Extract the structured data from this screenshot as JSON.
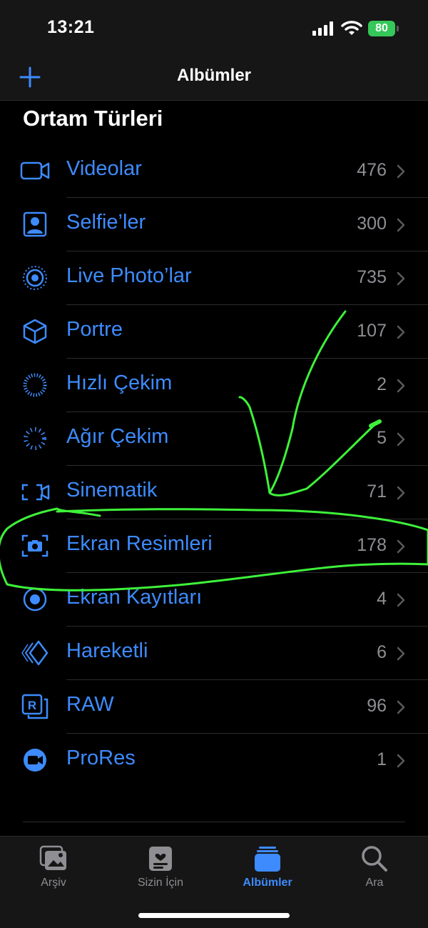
{
  "status_bar": {
    "time": "13:21",
    "battery_level": "80",
    "battery_color": "#34c759"
  },
  "nav": {
    "title": "Albümler",
    "add_icon": "plus-icon"
  },
  "section": {
    "title": "Ortam Türleri"
  },
  "media_types": [
    {
      "label": "Videolar",
      "count": "476",
      "icon": "video-icon"
    },
    {
      "label": "Selfie’ler",
      "count": "300",
      "icon": "selfie-icon"
    },
    {
      "label": "Live Photo’lar",
      "count": "735",
      "icon": "live-photo-icon"
    },
    {
      "label": "Portre",
      "count": "107",
      "icon": "portrait-cube-icon"
    },
    {
      "label": "Hızlı Çekim",
      "count": "2",
      "icon": "timelapse-icon"
    },
    {
      "label": "Ağır Çekim",
      "count": "5",
      "icon": "slow-motion-icon"
    },
    {
      "label": "Sinematik",
      "count": "71",
      "icon": "cinematic-icon"
    },
    {
      "label": "Ekran Resimleri",
      "count": "178",
      "icon": "screenshot-icon"
    },
    {
      "label": "Ekran Kayıtları",
      "count": "4",
      "icon": "screen-recording-icon"
    },
    {
      "label": "Hareketli",
      "count": "6",
      "icon": "animated-icon"
    },
    {
      "label": "RAW",
      "count": "96",
      "icon": "raw-icon"
    },
    {
      "label": "ProRes",
      "count": "1",
      "icon": "prores-icon"
    }
  ],
  "tabs": [
    {
      "label": "Arşiv",
      "icon": "library-photos-icon",
      "active": false
    },
    {
      "label": "Sizin İçin",
      "icon": "for-you-icon",
      "active": false
    },
    {
      "label": "Albümler",
      "icon": "albums-icon",
      "active": true
    },
    {
      "label": "Ara",
      "icon": "search-icon",
      "active": false
    }
  ],
  "colors": {
    "accent": "#3d8bfd",
    "secondary_text": "#8e8e93",
    "annotation": "#3ef23a"
  }
}
